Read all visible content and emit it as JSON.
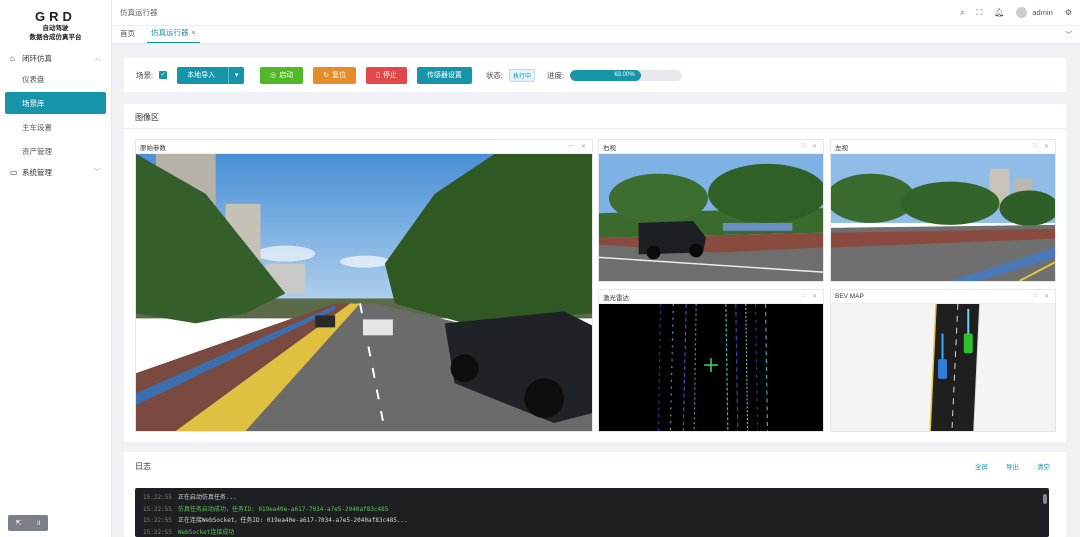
{
  "logo": {
    "main": "GRD",
    "sub1": "自动驾驶",
    "sub2": "数据合成仿真平台"
  },
  "sidebar": {
    "groups": [
      {
        "label": "闭环仿真",
        "items": [
          "仪表盘",
          "场景库",
          "主车设置",
          "资产管理"
        ],
        "active": "场景库"
      },
      {
        "label": "系统管理"
      }
    ]
  },
  "header": {
    "title": "仿真运行器",
    "user": "admin"
  },
  "tabs": [
    {
      "label": "首页"
    },
    {
      "label": "仿真运行器"
    }
  ],
  "toolbar": {
    "scene_label": "场景:",
    "import_label": "本地导入",
    "start_label": "启动",
    "reset_label": "复位",
    "stop_label": "停止",
    "sensor_label": "传感器设置",
    "status_label": "状态:",
    "status_value": "执行中",
    "progress_label": "进度:",
    "progress_value": 0.63,
    "progress_text": "63.00%"
  },
  "image_area": {
    "title": "图像区",
    "views": {
      "main": "原始参数",
      "right": "右视",
      "left": "左视",
      "lidar": "激光雷达",
      "bev": "BEV MAP"
    }
  },
  "log": {
    "title": "日志",
    "actions": [
      "全屏",
      "导出",
      "清空"
    ],
    "lines": [
      {
        "time": "15:22:55",
        "text": "正在启动仿真任务...",
        "color": "white"
      },
      {
        "time": "15:22:55",
        "text": "仿真任务启动成功，任务ID: 019ea40e-a617-7034-a7e5-2040af83c485",
        "color": "green"
      },
      {
        "time": "15:22:55",
        "text": "正在连接WebSocket，任务ID: 019ea40e-a617-7034-a7e5-2040af83c485...",
        "color": "white"
      },
      {
        "time": "15:22:55",
        "text": "WebSocket连接成功",
        "color": "green"
      }
    ]
  },
  "colors": {
    "accent": "#1795a8",
    "start": "#52b829",
    "reset": "#e58c28",
    "stop": "#e0484a"
  }
}
